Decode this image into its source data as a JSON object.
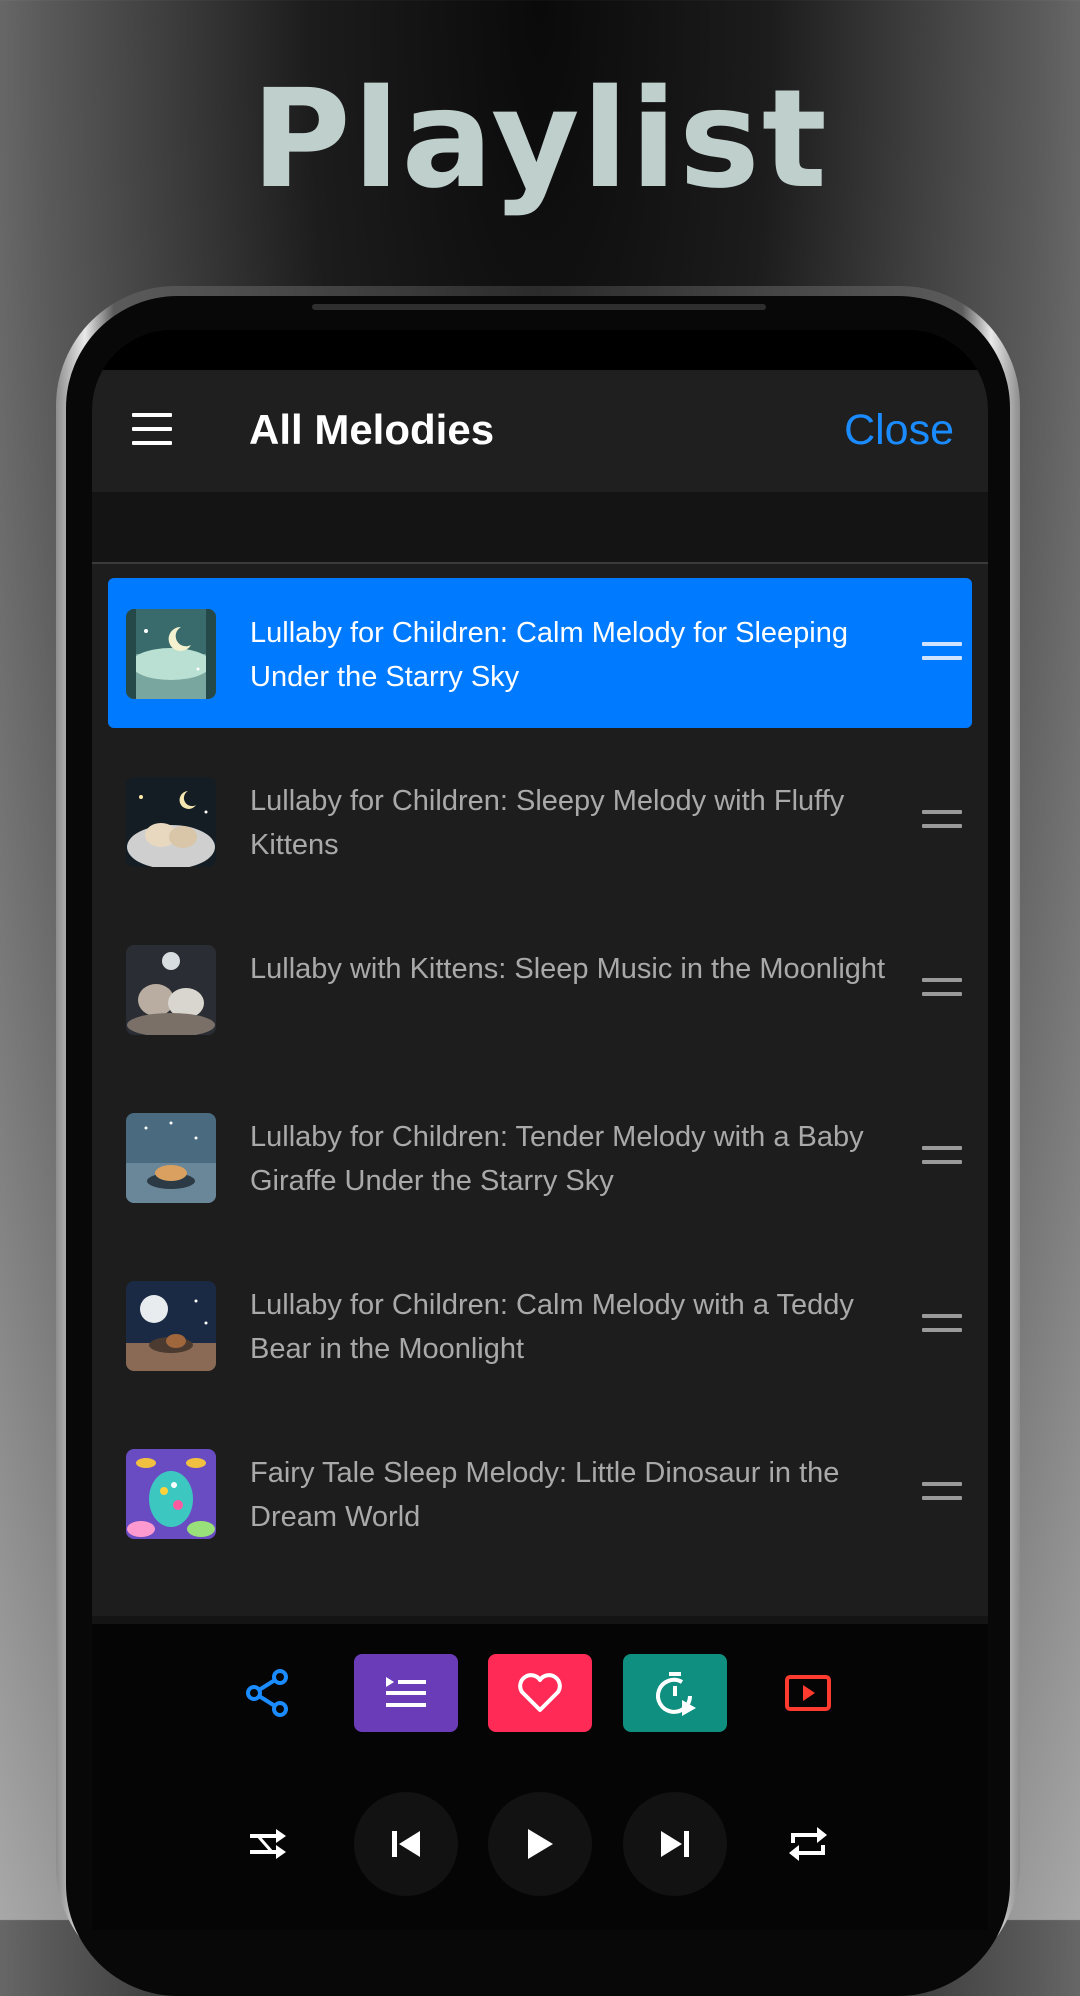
{
  "promo": {
    "title": "Playlist"
  },
  "header": {
    "title": "All Melodies",
    "close_label": "Close"
  },
  "tracks": [
    {
      "title": "Lullaby for Children: Calm Melody for Sleeping Under the Starry Sky",
      "active": true
    },
    {
      "title": "Lullaby for Children: Sleepy Melody with Fluffy Kittens",
      "active": false
    },
    {
      "title": "Lullaby with Kittens: Sleep Music in the Moonlight",
      "active": false
    },
    {
      "title": "Lullaby for Children: Tender Melody with a Baby Giraffe Under the Starry Sky",
      "active": false
    },
    {
      "title": "Lullaby for Children: Calm Melody with a Teddy Bear in the Moonlight",
      "active": false
    },
    {
      "title": "Fairy Tale Sleep Melody: Little Dinosaur in the Dream World",
      "active": false
    }
  ],
  "actions": [
    {
      "name": "share-icon",
      "color": "#1a8cff"
    },
    {
      "name": "queue-list-icon",
      "color": "#6a3cb8"
    },
    {
      "name": "heart-icon",
      "color": "#ff2a55"
    },
    {
      "name": "timer-icon",
      "color": "#0f8f7f"
    },
    {
      "name": "video-play-icon",
      "color": "#ff3b30"
    }
  ],
  "controls": [
    "shuffle-icon",
    "previous-icon",
    "play-icon",
    "next-icon",
    "repeat-icon"
  ]
}
